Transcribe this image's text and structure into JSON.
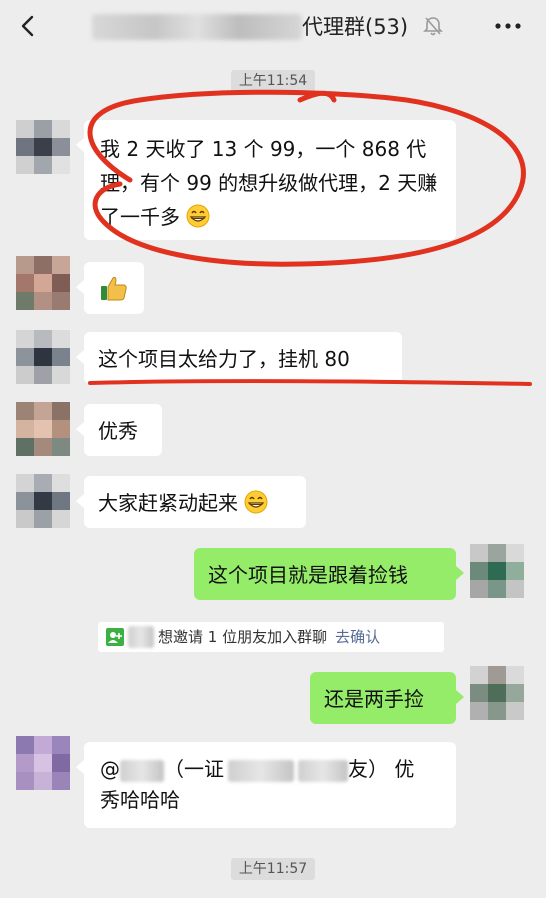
{
  "header": {
    "title": "代理群(53)",
    "back_icon": "chevron-left-icon",
    "mute_icon": "bell-off-icon",
    "more_icon": "more-dots-icon"
  },
  "timestamps": {
    "top": "上午11:54",
    "bottom": "上午11:57"
  },
  "messages": [
    {
      "side": "left",
      "text": "我 2 天收了 13 个 99，一个 868 代理，有个 99 的想升级做代理，2 天赚了一千多",
      "emoji": "grin"
    },
    {
      "side": "left",
      "emoji": "thumbs-up"
    },
    {
      "side": "left",
      "text": "这个项目太给力了，挂机 80"
    },
    {
      "side": "left",
      "text": "优秀"
    },
    {
      "side": "left",
      "text": "大家赶紧动起来",
      "emoji": "grin"
    },
    {
      "side": "right",
      "text": "这个项目就是跟着捡钱"
    },
    {
      "side": "right",
      "text": "还是两手捡"
    },
    {
      "side": "left",
      "text_parts": [
        "@",
        "（一证",
        "",
        "",
        "友）  优",
        "秀哈哈哈"
      ]
    }
  ],
  "system_notice": {
    "text": "想邀请 1 位朋友加入群聊",
    "link": "去确认"
  },
  "colors": {
    "background": "#ededed",
    "right_bubble": "#95ec69",
    "annotation": "#e0321e",
    "link": "#576b95"
  }
}
